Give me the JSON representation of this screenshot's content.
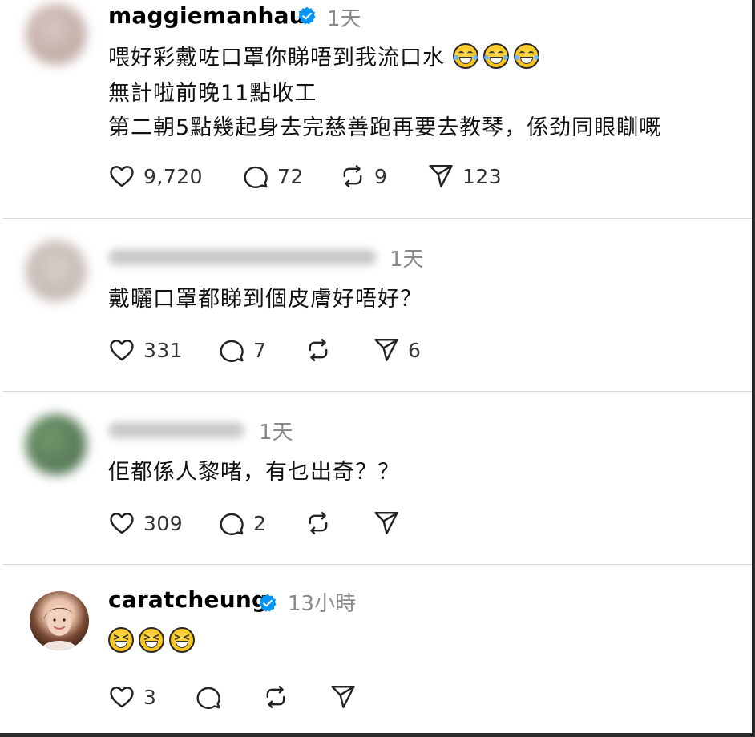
{
  "posts": [
    {
      "username": "maggiemanhau",
      "verified": true,
      "time": "1天",
      "lines": [
        "喂好彩戴咗口罩你睇唔到我流口水",
        "無計啦前晚11點收工",
        "第二朝5點幾起身去完慈善跑再要去教琴，係劲同眼瞓嘅"
      ],
      "emojis": [
        "joy-emoji",
        "joy-emoji",
        "joy-emoji"
      ],
      "likes": "9,720",
      "comments": "72",
      "reposts": "9",
      "shares": "123"
    },
    {
      "username": "",
      "verified": false,
      "time": "1天",
      "lines": [
        "戴曬口罩都睇到個皮膚好唔好？"
      ],
      "likes": "331",
      "comments": "7",
      "reposts": "",
      "shares": "6"
    },
    {
      "username": "",
      "verified": false,
      "time": "1天",
      "lines": [
        "佢都係人黎啫，有乜出奇？？"
      ],
      "likes": "309",
      "comments": "2",
      "reposts": "",
      "shares": ""
    },
    {
      "username": "caratcheung",
      "verified": true,
      "time": "13小時",
      "emojis": [
        "laughing-emoji",
        "laughing-emoji",
        "laughing-emoji"
      ],
      "likes": "3",
      "comments": "",
      "reposts": "",
      "shares": ""
    }
  ],
  "colors": {
    "verified": "#0095f6",
    "meta": "#8a8a8a",
    "divider": "#d6d6d6"
  },
  "icons": [
    "heart-icon",
    "comment-icon",
    "repost-icon",
    "share-icon",
    "verified-icon"
  ]
}
